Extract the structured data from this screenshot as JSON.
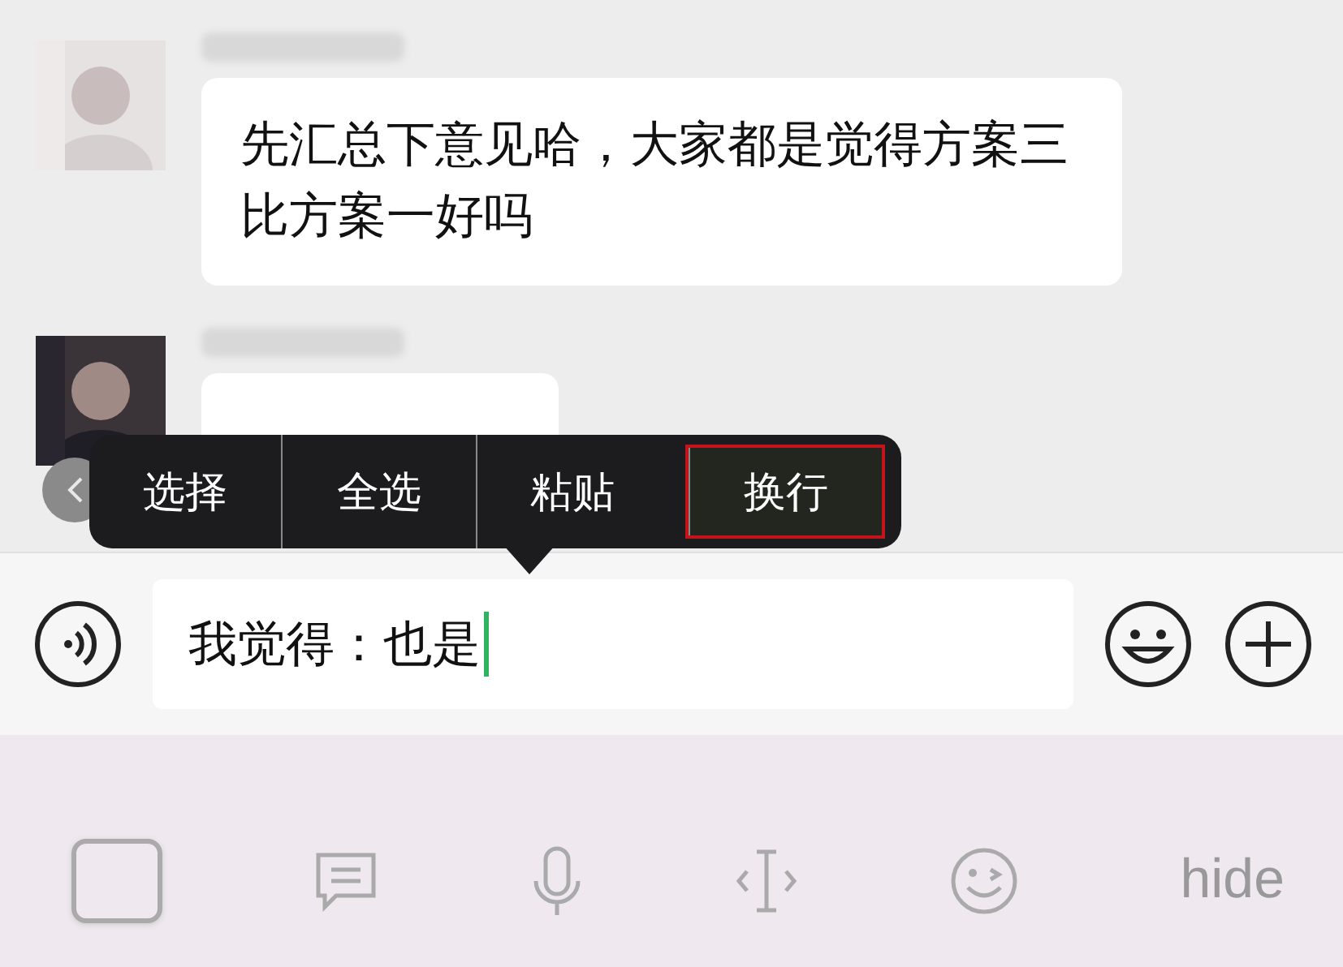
{
  "messages": [
    {
      "kind": "text",
      "text": "先汇总下意见哈，大家都是觉得方案三比方案一好吗"
    },
    {
      "kind": "hidden"
    }
  ],
  "edit_menu": {
    "items": [
      {
        "label": "选择",
        "selected": false
      },
      {
        "label": "全选",
        "selected": false
      },
      {
        "label": "粘贴",
        "selected": false
      },
      {
        "label": "换行",
        "selected": true
      }
    ]
  },
  "input": {
    "value": "我觉得：也是"
  },
  "keyboard_toolbar": {
    "hide_label": "hide"
  }
}
